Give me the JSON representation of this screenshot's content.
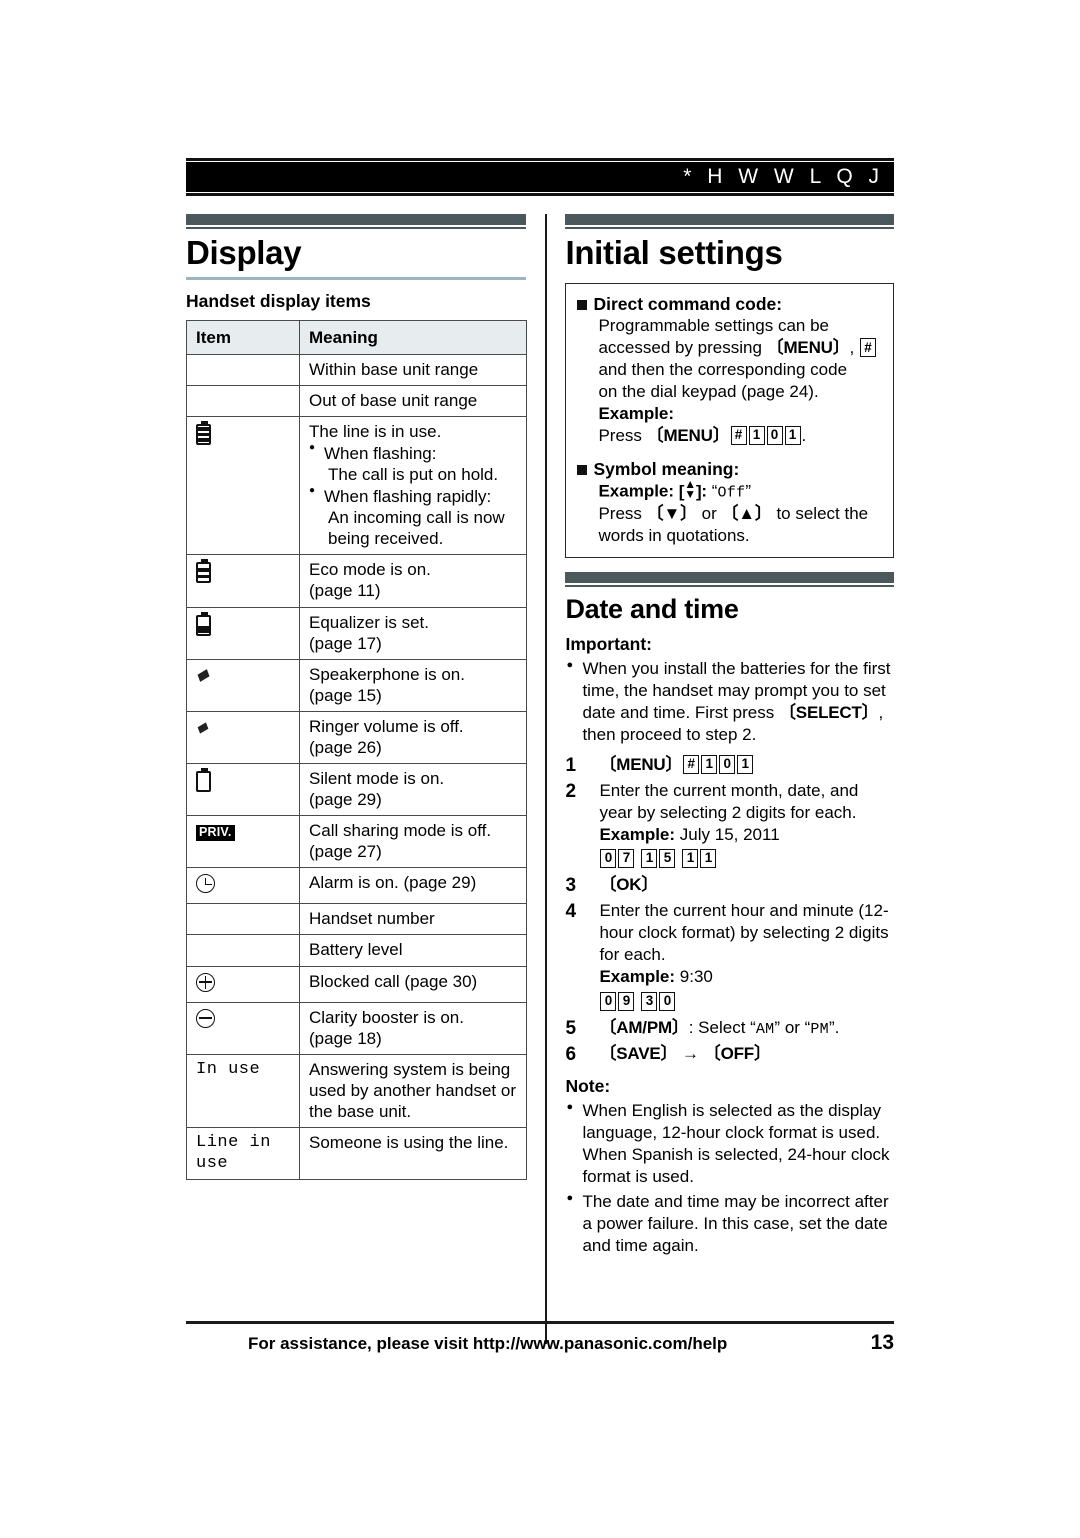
{
  "running_header": {
    "text": "* H W W L Q J"
  },
  "left_column": {
    "section_title": "Display",
    "subheading": "Handset display items",
    "table": {
      "headers": [
        "Item",
        "Meaning"
      ],
      "rows": [
        {
          "icon": "none",
          "meaning": "Within base unit range"
        },
        {
          "icon": "none",
          "meaning": "Out of base unit range"
        },
        {
          "icon": "battery-full-icon",
          "meaning": "The line is in use.",
          "bullets": [
            {
              "label": "When flashing:",
              "cont": "The call is put on hold."
            },
            {
              "label": "When flashing rapidly:",
              "cont": "An incoming call is now being received."
            }
          ]
        },
        {
          "icon": "battery-eco-icon",
          "meaning": "Eco mode is on.",
          "page": "(page 11)"
        },
        {
          "icon": "battery-equalizer-icon",
          "meaning": "Equalizer is set.",
          "page": "(page 17)"
        },
        {
          "icon": "speaker-mark-icon",
          "meaning": "Speakerphone is on.",
          "page": "(page 15)"
        },
        {
          "icon": "ringer-off-mark-icon",
          "meaning": "Ringer volume is off.",
          "page": "(page 26)"
        },
        {
          "icon": "battery-empty-icon",
          "meaning": "Silent mode is on.",
          "page": "(page 29)"
        },
        {
          "icon": "priv-badge-icon",
          "icon_text": "PRIV.",
          "meaning": "Call sharing mode is off.",
          "page": "(page 27)"
        },
        {
          "icon": "alarm-clock-icon",
          "meaning": "Alarm is on. (page 29)"
        },
        {
          "icon": "none",
          "meaning": "Handset number"
        },
        {
          "icon": "none",
          "meaning": "Battery level"
        },
        {
          "icon": "circled-plus-icon",
          "meaning": "Blocked call (page 30)"
        },
        {
          "icon": "circled-minus-icon",
          "meaning": "Clarity booster is on.",
          "page": "(page 18)"
        },
        {
          "icon": "lcd-text",
          "icon_text": "In use",
          "meaning": "Answering system is being used by another handset or the base unit."
        },
        {
          "icon": "lcd-text",
          "icon_text": "Line in use",
          "meaning": "Someone is using the line."
        }
      ]
    }
  },
  "right_column": {
    "section_title": "Initial settings",
    "box": {
      "direct_heading": "Direct command code:",
      "direct_body_1": "Programmable settings can be",
      "direct_body_2_a": "accessed by pressing",
      "direct_body_2_menu": "{MENU}",
      "direct_body_2_comma": ",",
      "direct_body_2_hash": "#",
      "direct_body_3": "and then the corresponding code",
      "direct_body_4": "on the dial keypad (page 24).",
      "example_label": "Example:",
      "example_press": "Press",
      "example_menu": "{MENU}",
      "example_keys": [
        "#",
        "1",
        "0",
        "1"
      ],
      "example_period": ".",
      "symbol_heading": "Symbol meaning:",
      "symbol_example_label": "Example:",
      "symbol_example_key": "{↕}",
      "symbol_example_colon": ":",
      "symbol_example_value": "Off",
      "symbol_press_1": "Press",
      "symbol_key_down": "{▼}",
      "symbol_or": "or",
      "symbol_key_up": "{▲}",
      "symbol_press_2": "to select the",
      "symbol_press_3": "words in quotations."
    },
    "date_time": {
      "section_title": "Date and time",
      "important_label": "Important:",
      "important_bullet_a": "When you install the batteries for the first time, the handset may prompt you to set date and time. First press",
      "important_bullet_key": "{SELECT}",
      "important_bullet_b": ", then proceed to step 2.",
      "steps": [
        {
          "num": "1",
          "type": "keys",
          "menu": "{MENU}",
          "keys": [
            "#",
            "1",
            "0",
            "1"
          ]
        },
        {
          "num": "2",
          "type": "text",
          "text": "Enter the current month, date, and year by selecting 2 digits for each.",
          "example_label": "Example:",
          "example_value": "July 15, 2011",
          "digit_groups": [
            [
              "0",
              "7"
            ],
            [
              "1",
              "5"
            ],
            [
              "1",
              "1"
            ]
          ]
        },
        {
          "num": "3",
          "type": "single_key",
          "key": "{OK}"
        },
        {
          "num": "4",
          "type": "text",
          "text": "Enter the current hour and minute (12-hour clock format) by selecting 2 digits for each.",
          "example_label": "Example:",
          "example_value": "9:30",
          "digit_groups": [
            [
              "0",
              "9"
            ],
            [
              "3",
              "0"
            ]
          ]
        },
        {
          "num": "5",
          "type": "ampm",
          "key": "{AM/PM}",
          "text_a": ": Select",
          "lcd_am": "AM",
          "text_or": "or",
          "lcd_pm": "PM",
          "text_end": "."
        },
        {
          "num": "6",
          "type": "two_keys",
          "key1": "{SAVE}",
          "arrow": "→",
          "key2": "{OFF}"
        }
      ],
      "note_label": "Note:",
      "notes": [
        "When English is selected as the display language, 12-hour clock format is used. When Spanish is selected, 24-hour clock format is used.",
        "The date and time may be incorrect after a power failure. In this case, set the date and time again."
      ]
    }
  },
  "footer": {
    "assistance_text": "For assistance, please visit http://www.panasonic.com/help",
    "page_number": "13"
  },
  "colors": {
    "section_bar": "#4b585c",
    "title_rule": "#9db4bd",
    "table_header_bg": "#e7edee",
    "header_bar_bg": "#000000"
  }
}
